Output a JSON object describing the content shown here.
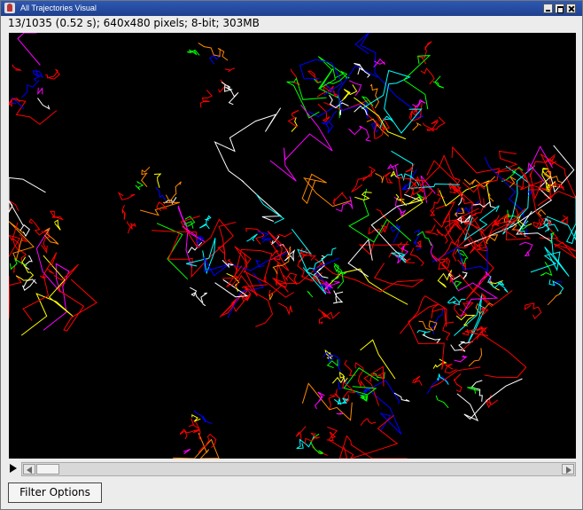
{
  "window": {
    "title": "All Trajectories Visual"
  },
  "image_info": "13/1035 (0.52 s); 640x480 pixels; 8-bit; 303MB",
  "stack": {
    "current_frame": 13,
    "total_frames": 1035
  },
  "buttons": {
    "filter_options": "Filter Options"
  },
  "icons": {
    "app": "imagej-app-icon",
    "play": "play-icon",
    "minimize": "minimize-icon",
    "maximize": "maximize-icon",
    "close": "close-icon"
  },
  "colors": {
    "canvas_background": "#000000",
    "dominant_trajectory": "#ff0000",
    "trajectory_palette": [
      "#ff0000",
      "#ff0000",
      "#ff0000",
      "#ff0000",
      "#ff0000",
      "#ff0000",
      "#ffff00",
      "#00ffff",
      "#ff00ff",
      "#ffffff",
      "#00ff00",
      "#0000ff",
      "#ff8800"
    ],
    "titlebar": "#2d59b4"
  }
}
